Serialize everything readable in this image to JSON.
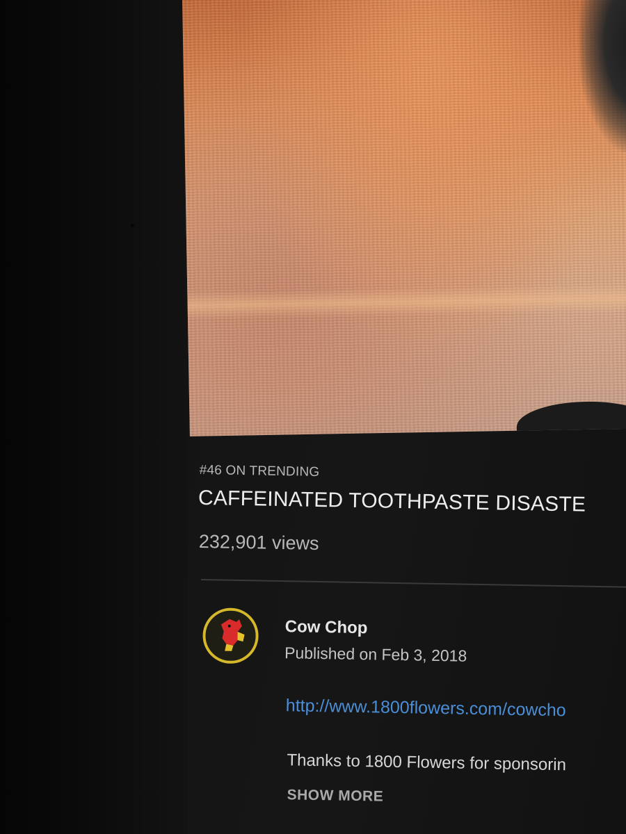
{
  "video": {
    "trending_label": "#46 ON TRENDING",
    "title": "CAFFEINATED TOOTHPASTE DISASTE",
    "views": "232,901 views"
  },
  "channel": {
    "name": "Cow Chop",
    "published": "Published on Feb 3, 2018",
    "avatar_icon": "cow-chop-logo-icon",
    "accent_color": "#d6b92a"
  },
  "description": {
    "link": "http://www.1800flowers.com/cowcho",
    "text": "Thanks to 1800 Flowers for sponsorin",
    "show_more_label": "SHOW MORE",
    "link_color": "#4a8ed8"
  }
}
